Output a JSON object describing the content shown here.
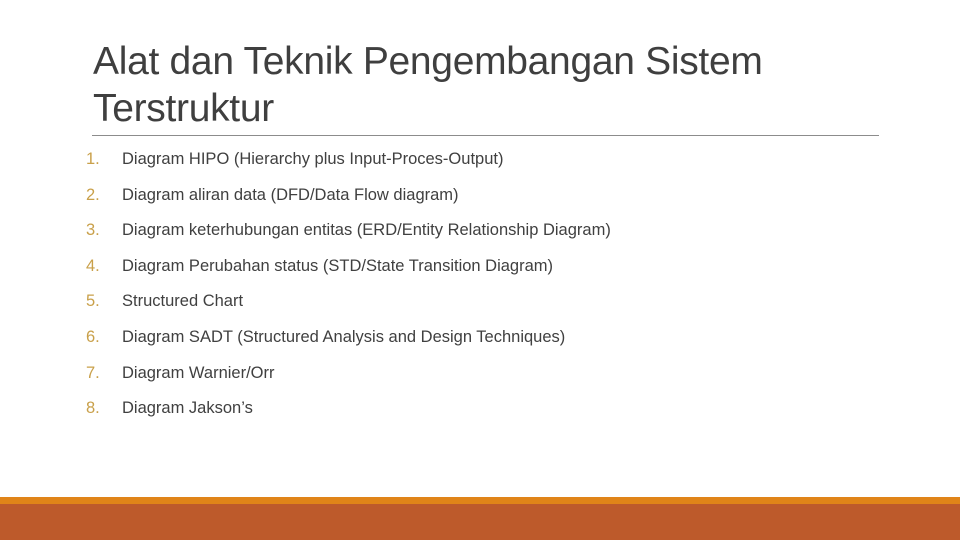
{
  "slide": {
    "title_lines": [
      "Alat dan Teknik Pengembangan Sistem",
      "Terstruktur"
    ],
    "items": [
      {
        "number": "1.",
        "text": "Diagram HIPO (Hierarchy plus Input-Proces-Output)"
      },
      {
        "number": "2.",
        "text": "Diagram aliran data (DFD/Data Flow diagram)"
      },
      {
        "number": "3.",
        "text": "Diagram keterhubungan entitas (ERD/Entity Relationship Diagram)"
      },
      {
        "number": "4.",
        "text": "Diagram Perubahan status (STD/State Transition Diagram)"
      },
      {
        "number": "5.",
        "text": "Structured Chart"
      },
      {
        "number": "6.",
        "text": "Diagram SADT (Structured Analysis and Design Techniques)"
      },
      {
        "number": "7.",
        "text": "Diagram Warnier/Orr"
      },
      {
        "number": "8.",
        "text": "Diagram Jakson’s"
      }
    ]
  },
  "theme": {
    "number_color": "#c9a04a",
    "text_color": "#404040",
    "footer_stripe_color": "#e08418",
    "footer_band_color": "#bd5a2b"
  }
}
